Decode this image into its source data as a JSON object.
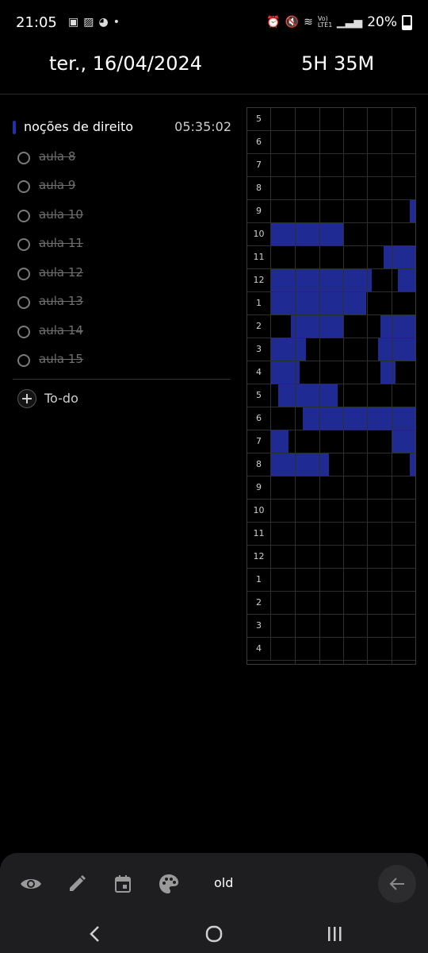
{
  "status_bar": {
    "time": "21:05",
    "left_icons": [
      "gallery-icon",
      "stripes-icon",
      "pet-icon",
      "dot-icon"
    ],
    "right_icons": [
      "alarm-icon",
      "mute-icon",
      "wifi-icon",
      "volte-icon",
      "signal-icon"
    ],
    "lte_text": "Vo) LTE1",
    "battery": "20%",
    "battery_level": 0.2
  },
  "header": {
    "date": "ter., 16/04/2024",
    "duration": "5H 35M"
  },
  "category": {
    "name": "noções de direito",
    "time": "05:35:02",
    "color": "#2430a8"
  },
  "tasks": [
    {
      "label": "aula 8",
      "done": true
    },
    {
      "label": "aula 9",
      "done": true
    },
    {
      "label": "aula 10",
      "done": true
    },
    {
      "label": "aula 11",
      "done": true
    },
    {
      "label": "aula 12",
      "done": true
    },
    {
      "label": "aula 13",
      "done": true
    },
    {
      "label": "aula 14",
      "done": true
    },
    {
      "label": "aula 15",
      "done": true
    }
  ],
  "todo": {
    "label": "To-do",
    "icon": "plus-icon"
  },
  "timeline": {
    "hours": [
      "5",
      "6",
      "7",
      "8",
      "9",
      "10",
      "11",
      "12",
      "1",
      "2",
      "3",
      "4",
      "5",
      "6",
      "7",
      "8",
      "9",
      "10",
      "11",
      "12",
      "1",
      "2",
      "3",
      "4"
    ],
    "block_color": "#1f2a93",
    "blocks": [
      {
        "row": 4,
        "start": 0.96,
        "end": 1.0
      },
      {
        "row": 5,
        "start": 0.0,
        "end": 0.5
      },
      {
        "row": 6,
        "start": 0.78,
        "end": 1.0
      },
      {
        "row": 7,
        "start": 0.0,
        "end": 0.7
      },
      {
        "row": 7,
        "start": 0.88,
        "end": 1.0
      },
      {
        "row": 8,
        "start": 0.0,
        "end": 0.66
      },
      {
        "row": 9,
        "start": 0.14,
        "end": 0.5
      },
      {
        "row": 9,
        "start": 0.76,
        "end": 1.0
      },
      {
        "row": 10,
        "start": 0.0,
        "end": 0.24
      },
      {
        "row": 10,
        "start": 0.74,
        "end": 1.0
      },
      {
        "row": 11,
        "start": 0.0,
        "end": 0.2
      },
      {
        "row": 11,
        "start": 0.76,
        "end": 0.86
      },
      {
        "row": 12,
        "start": 0.05,
        "end": 0.46
      },
      {
        "row": 13,
        "start": 0.22,
        "end": 1.0
      },
      {
        "row": 14,
        "start": 0.0,
        "end": 0.12
      },
      {
        "row": 14,
        "start": 0.84,
        "end": 1.0
      },
      {
        "row": 15,
        "start": 0.0,
        "end": 0.4
      },
      {
        "row": 15,
        "start": 0.96,
        "end": 1.0
      }
    ]
  },
  "toolbar": {
    "icons": [
      "eye-icon",
      "pencil-icon",
      "calendar-icon",
      "palette-icon"
    ],
    "old_label": "old",
    "back_icon": "arrow-left-icon"
  },
  "navbar": {
    "icons": [
      "nav-back-icon",
      "nav-home-icon",
      "nav-recents-icon"
    ]
  }
}
